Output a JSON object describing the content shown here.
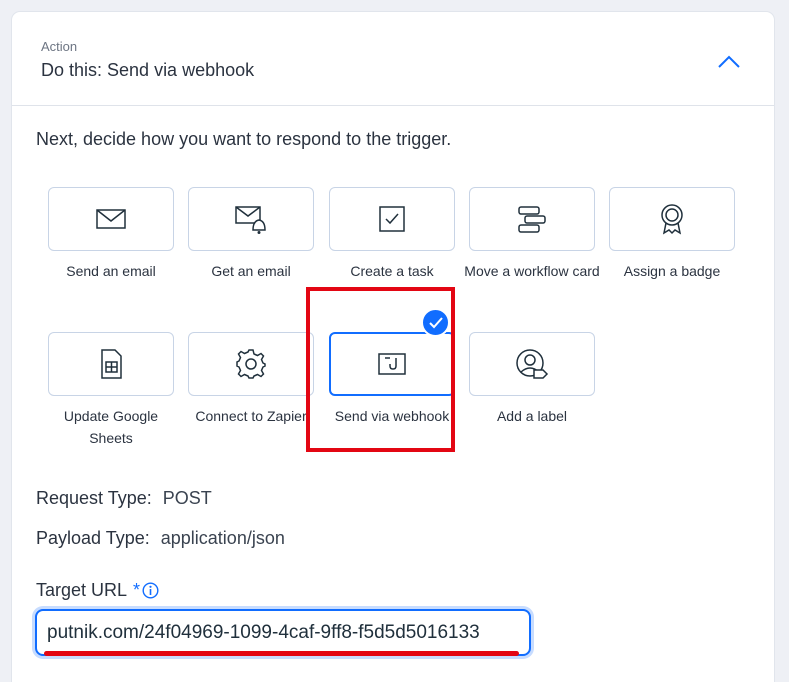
{
  "header": {
    "kicker": "Action",
    "title": "Do this: Send via webhook"
  },
  "prompt": "Next, decide how you want to respond to the trigger.",
  "actions": [
    {
      "label": "Send an email",
      "icon": "envelope-icon"
    },
    {
      "label": "Get an email",
      "icon": "envelope-bell-icon"
    },
    {
      "label": "Create a task",
      "icon": "checkbox-icon"
    },
    {
      "label": "Move a workflow card",
      "icon": "workflow-card-icon"
    },
    {
      "label": "Assign a badge",
      "icon": "badge-icon"
    },
    {
      "label": "Update Google Sheets",
      "icon": "spreadsheet-icon"
    },
    {
      "label": "Connect to Zapier",
      "icon": "gear-icon"
    },
    {
      "label": "Send via webhook",
      "icon": "webhook-icon",
      "selected": true
    },
    {
      "label": "Add a label",
      "icon": "user-label-icon"
    }
  ],
  "request_type": {
    "label": "Request Type:",
    "value": "POST"
  },
  "payload_type": {
    "label": "Payload Type:",
    "value": "application/json"
  },
  "target_url": {
    "label": "Target URL",
    "required_marker": "*",
    "value": "putnik.com/24f04969-1099-4caf-9ff8-f5d5d5016133"
  },
  "colors": {
    "accent": "#116dff",
    "annotation": "#e30613",
    "tile_border": "#c8d4e6"
  }
}
